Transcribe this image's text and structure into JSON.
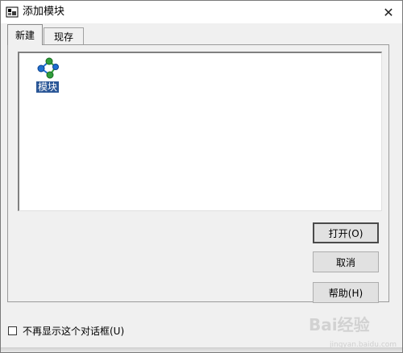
{
  "window": {
    "title": "添加模块",
    "close_glyph": "✕"
  },
  "tabs": [
    {
      "label": "新建",
      "active": true
    },
    {
      "label": "现存",
      "active": false
    }
  ],
  "list": {
    "items": [
      {
        "label": "模块",
        "icon": "module-icon",
        "selected": true
      }
    ]
  },
  "buttons": {
    "open": "打开(O)",
    "cancel": "取消",
    "help": "帮助(H)"
  },
  "checkbox": {
    "label": "不再显示这个对话框(U)",
    "checked": false
  },
  "watermark": {
    "logo": "Bai经验",
    "subtext": "jingyan.baidu.com"
  },
  "colors": {
    "selection": "#2b5797",
    "panel": "#f0f0f0",
    "icon_blue": "#1f6fd1",
    "icon_green": "#2f9e3a"
  }
}
